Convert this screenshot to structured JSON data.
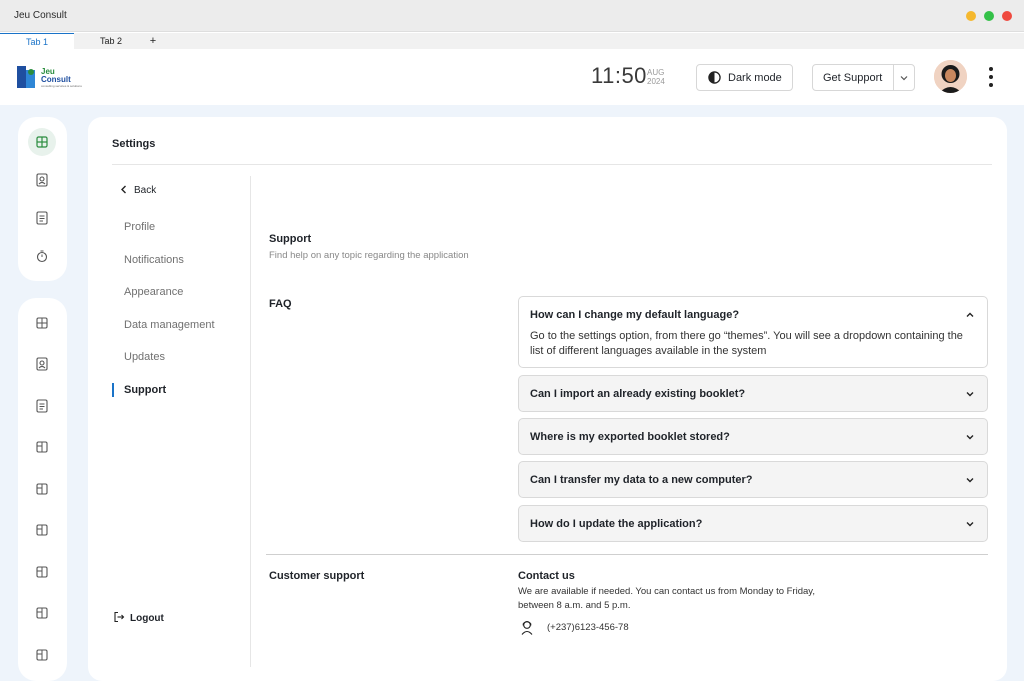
{
  "window": {
    "title": "Jeu Consult"
  },
  "tabs": [
    {
      "label": "Tab 1"
    },
    {
      "label": "Tab 2"
    },
    {
      "label": "+"
    }
  ],
  "brand": {
    "line1": "Jeu",
    "line2": "Consult",
    "tagline": "consulting services & solutions"
  },
  "header": {
    "time": "11:50",
    "month": "AUG",
    "year": "2024",
    "dark_mode_label": "Dark mode",
    "get_support_label": "Get Support"
  },
  "page": {
    "title": "Settings"
  },
  "nav": {
    "back_label": "Back",
    "items": [
      {
        "label": "Profile"
      },
      {
        "label": "Notifications"
      },
      {
        "label": "Appearance"
      },
      {
        "label": "Data management"
      },
      {
        "label": "Updates"
      },
      {
        "label": "Support"
      }
    ],
    "logout_label": "Logout"
  },
  "support": {
    "title": "Support",
    "subtitle": "Find help on any topic regarding the application",
    "faq_title": "FAQ",
    "faq": [
      {
        "question": "How can I change my default language?",
        "answer": "Go to the settings option, from there go “themes”. You will see a dropdown containing the list of different languages available in the system"
      },
      {
        "question": "Can I import an already existing booklet?"
      },
      {
        "question": "Where is my exported booklet stored?"
      },
      {
        "question": "Can I transfer my data to a new computer?"
      },
      {
        "question": "How do I update the application?"
      }
    ],
    "customer_support_title": "Customer support",
    "contact_title": "Contact us",
    "contact_text": "We are available if needed. You can contact us from Monday to Friday, between 8 a.m. and 5 p.m.",
    "phone": "(+237)6123-456-78"
  },
  "colors": {
    "accent": "#1a73c8",
    "page_bg": "#eef4fb",
    "active_icon_bg": "#e8f2ec"
  }
}
